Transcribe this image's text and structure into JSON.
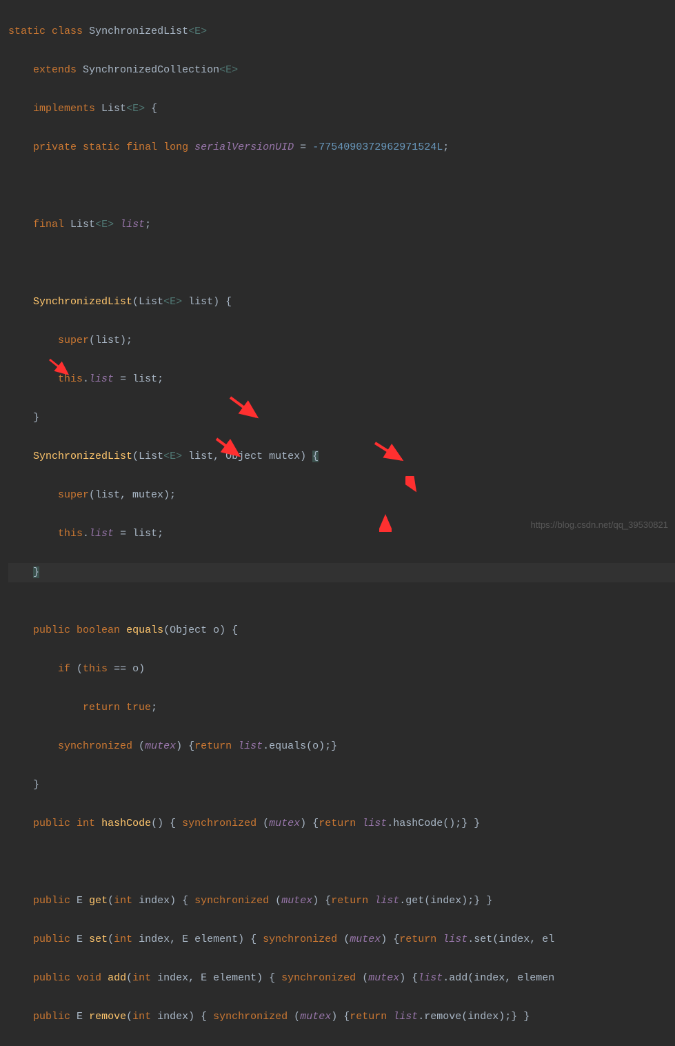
{
  "code": {
    "l01_kw1": "static",
    "l01_kw2": "class",
    "l01_cls": "SynchronizedList",
    "l01_gen": "<E>",
    "l02_kw1": "extends",
    "l02_cls": "SynchronizedCollection",
    "l02_gen": "<E>",
    "l03_kw1": "implements",
    "l03_cls": "List",
    "l03_gen": "<E>",
    "l03_brace": " {",
    "l04_kw1": "private",
    "l04_kw2": "static",
    "l04_kw3": "final",
    "l04_kw4": "long",
    "l04_field": "serialVersionUID",
    "l04_op": " = ",
    "l04_num": "-7754090372962971524L",
    "l04_semi": ";",
    "l06_kw1": "final",
    "l06_cls": "List",
    "l06_gen": "<E>",
    "l06_field": " list",
    "l06_semi": ";",
    "l08_ctor": "SynchronizedList",
    "l08_p1t": "List",
    "l08_p1g": "<E>",
    "l08_p1n": " list",
    "l08_brace": ") {",
    "l09_kw": "super",
    "l09_args": "(list);",
    "l10_kw": "this",
    "l10_dot": ".",
    "l10_field": "list",
    "l10_op": " = list;",
    "l11_brace": "}",
    "l12_ctor": "SynchronizedList",
    "l12_p1t": "List",
    "l12_p1g": "<E>",
    "l12_p1n": " list",
    "l12_sep": ", ",
    "l12_p2t": "Object",
    "l12_p2n": " mutex",
    "l12_brace": ") ",
    "l12_obrace": "{",
    "l13_kw": "super",
    "l13_args": "(list, mutex);",
    "l14_kw": "this",
    "l14_dot": ".",
    "l14_field": "list",
    "l14_op": " = list;",
    "l15_brace": "}",
    "l17_kw1": "public",
    "l17_kw2": "boolean",
    "l17_m": "equals",
    "l17_p": "(Object o) {",
    "l18_kw": "if",
    "l18_cond": " (",
    "l18_kw2": "this",
    "l18_op": " == o)",
    "l19_kw": "return",
    "l19_val": " true",
    "l19_semi": ";",
    "l20_kw": "synchronized",
    "l20_arg": " (",
    "l20_field": "mutex",
    "l20_close": ") {",
    "l20_kw2": "return",
    "l20_field2": " list",
    "l20_call": ".equals(o);}",
    "l21_brace": "}",
    "l22_kw1": "public",
    "l22_kw2": "int",
    "l22_m": "hashCode",
    "l22_p": "() { ",
    "l22_sync": "synchronized",
    "l22_arg": " (",
    "l22_field": "mutex",
    "l22_close": ") {",
    "l22_ret": "return",
    "l22_f2": " list",
    "l22_call": ".hashCode();} }",
    "l24_kw1": "public",
    "l24_t": "E",
    "l24_m": "get",
    "l24_p": "(",
    "l24_pk": "int",
    "l24_pn": " index) { ",
    "l24_sync": "synchronized",
    "l24_arg": " (",
    "l24_field": "mutex",
    "l24_close": ") {",
    "l24_ret": "return",
    "l24_f2": " list",
    "l24_call": ".get(index);} }",
    "l25_kw1": "public",
    "l25_t": "E",
    "l25_m": "set",
    "l25_p": "(",
    "l25_pk": "int",
    "l25_pn": " index, E element) { ",
    "l25_sync": "synchronized",
    "l25_arg": " (",
    "l25_field": "mutex",
    "l25_close": ") {",
    "l25_ret": "return",
    "l25_f2": " list",
    "l25_call": ".set(index, el",
    "l26_kw1": "public",
    "l26_kw2": "void",
    "l26_m": "add",
    "l26_p": "(",
    "l26_pk": "int",
    "l26_pn": " index, E element) { ",
    "l26_sync": "synchronized",
    "l26_arg": " (",
    "l26_field": "mutex",
    "l26_close": ") {",
    "l26_f2": "list",
    "l26_call": ".add(index, elemen",
    "l27_kw1": "public",
    "l27_t": "E",
    "l27_m": "remove",
    "l27_p": "(",
    "l27_pk": "int",
    "l27_pn": " index) { ",
    "l27_sync": "synchronized",
    "l27_arg": " (",
    "l27_field": "mutex",
    "l27_close": ") {",
    "l27_ret": "return",
    "l27_f2": " list",
    "l27_call": ".remove(index);} }"
  },
  "watermark": "https://blog.csdn.net/qq_39530821"
}
